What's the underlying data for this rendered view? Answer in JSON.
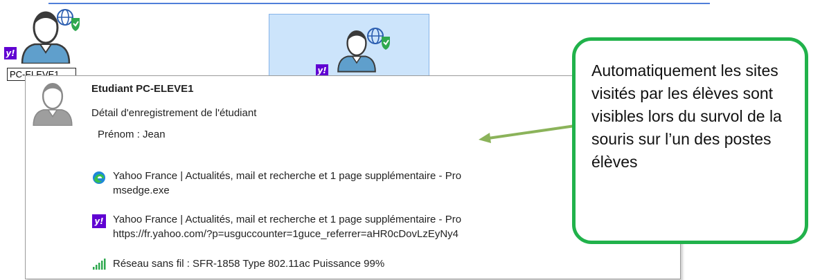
{
  "machines": [
    {
      "label": "PC-ELEVE1",
      "badge": "y!"
    },
    {
      "badge": "y!"
    }
  ],
  "tooltip": {
    "title": "Etudiant PC-ELEVE1",
    "subtitle": "Détail d'enregistrement de l'étudiant",
    "first_name": "Prénom : Jean",
    "entries": [
      {
        "icon": "edge-icon",
        "title": "Yahoo France | Actualités, mail et recherche et 1 page supplémentaire - Pro",
        "detail": "msedge.exe"
      },
      {
        "icon": "yahoo-icon",
        "badge": "y!",
        "title": "Yahoo France | Actualités, mail et recherche et 1 page supplémentaire - Pro",
        "detail": "https://fr.yahoo.com/?p=usguccounter=1guce_referrer=aHR0cDovLzEyNy4"
      }
    ],
    "network": "Réseau sans fil : SFR-1858 Type 802.11ac Puissance 99%"
  },
  "callout": {
    "text": "Automatiquement les sites visités par les élèves sont visibles lors du survol de la souris sur l’un des postes élèves"
  },
  "colors": {
    "callout_border": "#21b24b",
    "arrow": "#8bb35a",
    "yahoo": "#6001d2",
    "selection": "#cce4fb"
  }
}
